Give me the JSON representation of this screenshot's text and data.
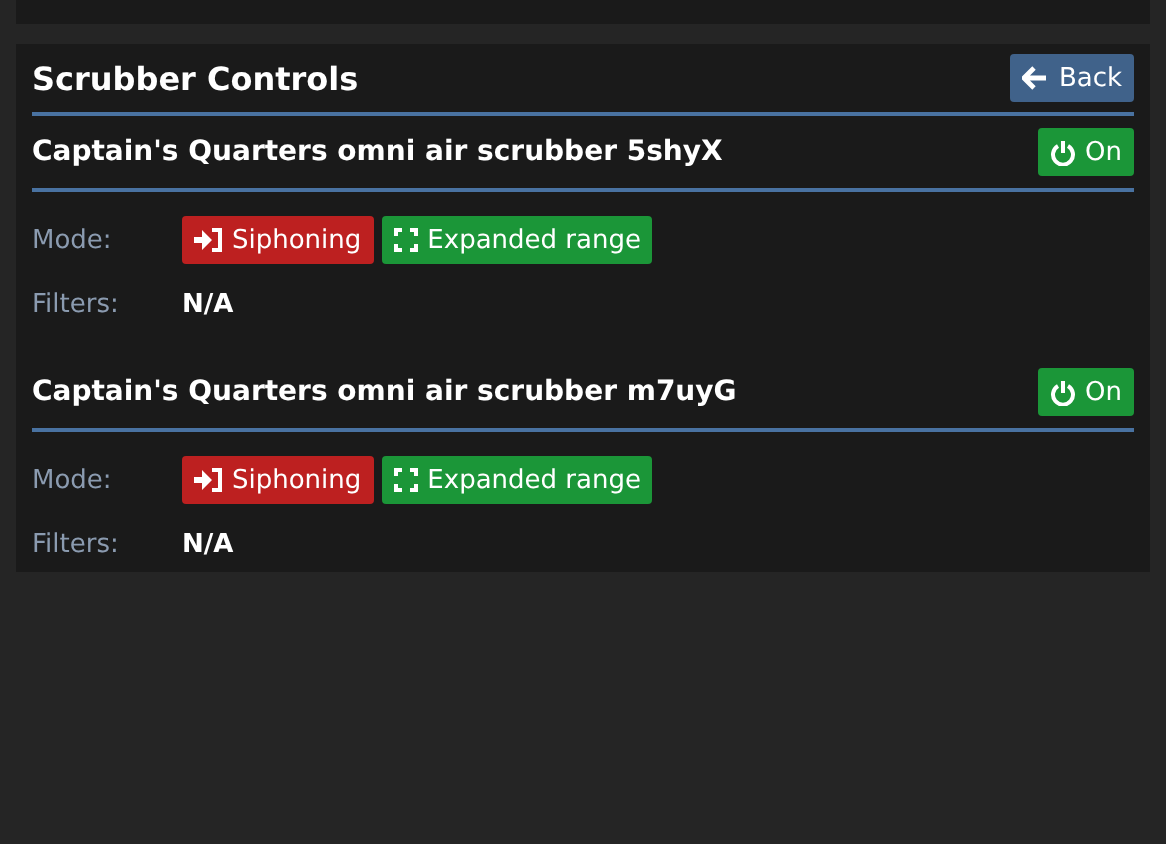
{
  "section": {
    "title": "Scrubber Controls",
    "back_button": "Back"
  },
  "scrubbers": [
    {
      "name": "Captain's Quarters omni air scrubber 5shyX",
      "power": {
        "label": "On",
        "on": true
      },
      "mode_label": "Mode:",
      "mode": {
        "label": "Siphoning",
        "siphoning": true
      },
      "range": {
        "label": "Expanded range",
        "expanded": true
      },
      "filters_label": "Filters:",
      "filters": "N/A"
    },
    {
      "name": "Captain's Quarters omni air scrubber m7uyG",
      "power": {
        "label": "On",
        "on": true
      },
      "mode_label": "Mode:",
      "mode": {
        "label": "Siphoning",
        "siphoning": true
      },
      "range": {
        "label": "Expanded range",
        "expanded": true
      },
      "filters_label": "Filters:",
      "filters": "N/A"
    }
  ]
}
